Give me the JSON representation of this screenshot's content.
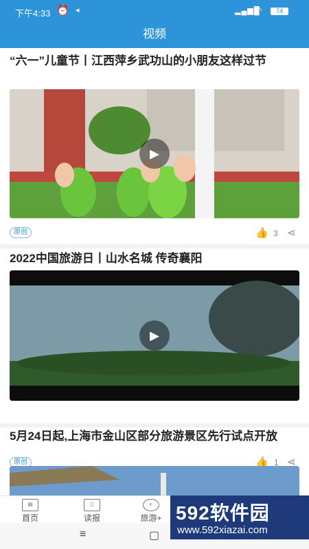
{
  "status": {
    "time": "下午4:33",
    "alarm_icon": "alarm-icon",
    "signal": "▂▄▆█",
    "battery": "74"
  },
  "title": "视频",
  "cards": [
    {
      "title": "“六一”儿童节丨江西萍乡武功山的小朋友这样过节",
      "tag": "原创",
      "likes": "3"
    },
    {
      "title": "2022中国旅游日丨山水名城 传奇襄阳",
      "tag": "原创",
      "likes": "1"
    },
    {
      "title": "5月24日起,上海市金山区部分旅游景区先行试点开放"
    }
  ],
  "nav": [
    {
      "label": "首页"
    },
    {
      "label": "读报"
    },
    {
      "label": "旅游+"
    }
  ],
  "watermark": {
    "line1": "592软件园",
    "line2": "www.592xiazai.com"
  },
  "colors": {
    "brand": "#2e94d9"
  }
}
